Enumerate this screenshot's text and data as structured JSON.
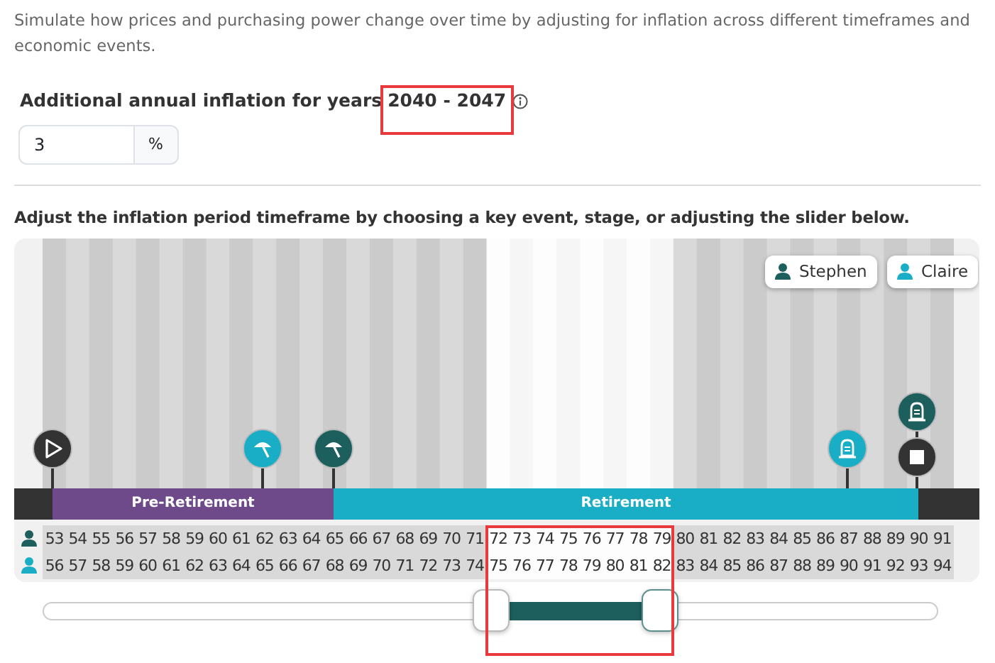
{
  "intro": "Simulate how prices and purchasing power change over time by adjusting for inflation across different timeframes and economic events.",
  "inflation": {
    "label": "Additional annual inflation for years",
    "years": "2040 - 2047",
    "highlighted": true,
    "value": "3",
    "unit": "%"
  },
  "timeline_heading": "Adjust the inflation period timeframe by choosing a key event, stage, or adjusting the slider below.",
  "people": [
    {
      "name": "Stephen",
      "color": "#1d5f5c"
    },
    {
      "name": "Claire",
      "color": "#1aaec6"
    }
  ],
  "markers": [
    {
      "kind": "start",
      "color": "#333333"
    },
    {
      "kind": "retire",
      "color": "#1aaec6"
    },
    {
      "kind": "retire",
      "color": "#1d5f5c"
    },
    {
      "kind": "death",
      "color": "#1aaec6"
    },
    {
      "kind": "death",
      "color": "#1d5f5c"
    },
    {
      "kind": "end",
      "color": "#333333"
    }
  ],
  "phases": [
    {
      "kind": "start",
      "color": "#333333"
    },
    {
      "kind": "pre",
      "label": "Pre-Retirement",
      "color": "#6e4a8a"
    },
    {
      "kind": "retire",
      "label": "Retirement",
      "color": "#1aaec6"
    },
    {
      "kind": "end",
      "color": "#333333"
    }
  ],
  "ages": [
    {
      "person_1": "53",
      "person_2": "56",
      "selected": false
    },
    {
      "person_1": "54",
      "person_2": "57",
      "selected": false
    },
    {
      "person_1": "55",
      "person_2": "58",
      "selected": false
    },
    {
      "person_1": "56",
      "person_2": "59",
      "selected": false
    },
    {
      "person_1": "57",
      "person_2": "60",
      "selected": false
    },
    {
      "person_1": "58",
      "person_2": "61",
      "selected": false
    },
    {
      "person_1": "59",
      "person_2": "62",
      "selected": false
    },
    {
      "person_1": "60",
      "person_2": "63",
      "selected": false
    },
    {
      "person_1": "61",
      "person_2": "64",
      "selected": false
    },
    {
      "person_1": "62",
      "person_2": "65",
      "selected": false
    },
    {
      "person_1": "63",
      "person_2": "66",
      "selected": false
    },
    {
      "person_1": "64",
      "person_2": "67",
      "selected": false
    },
    {
      "person_1": "65",
      "person_2": "68",
      "selected": false
    },
    {
      "person_1": "66",
      "person_2": "69",
      "selected": false
    },
    {
      "person_1": "67",
      "person_2": "70",
      "selected": false
    },
    {
      "person_1": "68",
      "person_2": "71",
      "selected": false
    },
    {
      "person_1": "69",
      "person_2": "72",
      "selected": false
    },
    {
      "person_1": "70",
      "person_2": "73",
      "selected": false
    },
    {
      "person_1": "71",
      "person_2": "74",
      "selected": false
    },
    {
      "person_1": "72",
      "person_2": "75",
      "selected": true
    },
    {
      "person_1": "73",
      "person_2": "76",
      "selected": true
    },
    {
      "person_1": "74",
      "person_2": "77",
      "selected": true
    },
    {
      "person_1": "75",
      "person_2": "78",
      "selected": true
    },
    {
      "person_1": "76",
      "person_2": "79",
      "selected": true
    },
    {
      "person_1": "77",
      "person_2": "80",
      "selected": true
    },
    {
      "person_1": "78",
      "person_2": "81",
      "selected": true
    },
    {
      "person_1": "79",
      "person_2": "82",
      "selected": true
    },
    {
      "person_1": "80",
      "person_2": "83",
      "selected": false
    },
    {
      "person_1": "81",
      "person_2": "84",
      "selected": false
    },
    {
      "person_1": "82",
      "person_2": "85",
      "selected": false
    },
    {
      "person_1": "83",
      "person_2": "86",
      "selected": false
    },
    {
      "person_1": "84",
      "person_2": "87",
      "selected": false
    },
    {
      "person_1": "85",
      "person_2": "88",
      "selected": false
    },
    {
      "person_1": "86",
      "person_2": "89",
      "selected": false
    },
    {
      "person_1": "87",
      "person_2": "90",
      "selected": false
    },
    {
      "person_1": "88",
      "person_2": "91",
      "selected": false
    },
    {
      "person_1": "89",
      "person_2": "92",
      "selected": false
    },
    {
      "person_1": "90",
      "person_2": "93",
      "selected": false
    },
    {
      "person_1": "91",
      "person_2": "94",
      "selected": false
    }
  ],
  "range_slider": {
    "highlighted": true,
    "thumbs": [
      {
        "level": 0.5
      },
      {
        "level": 0.69
      }
    ]
  }
}
